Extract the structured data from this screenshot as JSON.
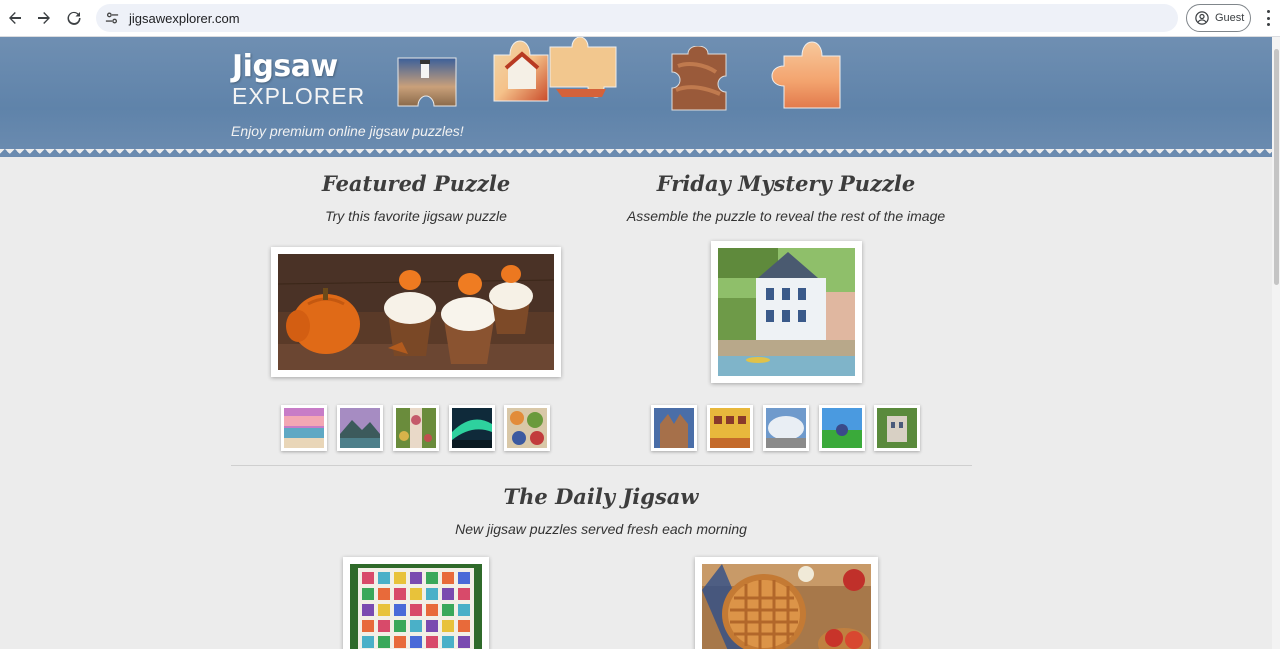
{
  "browser": {
    "url": "jigsawexplorer.com",
    "profile_label": "Guest"
  },
  "header": {
    "logo_top": "Jigsaw",
    "logo_bottom": "EXPLORER",
    "tagline": "Enjoy premium online jigsaw puzzles!"
  },
  "featured": {
    "title": "Featured Puzzle",
    "subtitle": "Try this favorite jigsaw puzzle"
  },
  "mystery": {
    "title": "Friday Mystery Puzzle",
    "subtitle": "Assemble the puzzle to reveal the rest of the image"
  },
  "daily": {
    "title": "The Daily Jigsaw",
    "subtitle": "New jigsaw puzzles served fresh each morning"
  },
  "icons": {
    "back": "back-arrow-icon",
    "forward": "forward-arrow-icon",
    "reload": "reload-icon",
    "site_settings": "tune-icon",
    "profile": "account-circle-icon",
    "menu": "more-vert-icon"
  },
  "colors": {
    "banner": "#6386ad",
    "page_bg": "#ececec",
    "title_text": "#3d3d3d"
  }
}
